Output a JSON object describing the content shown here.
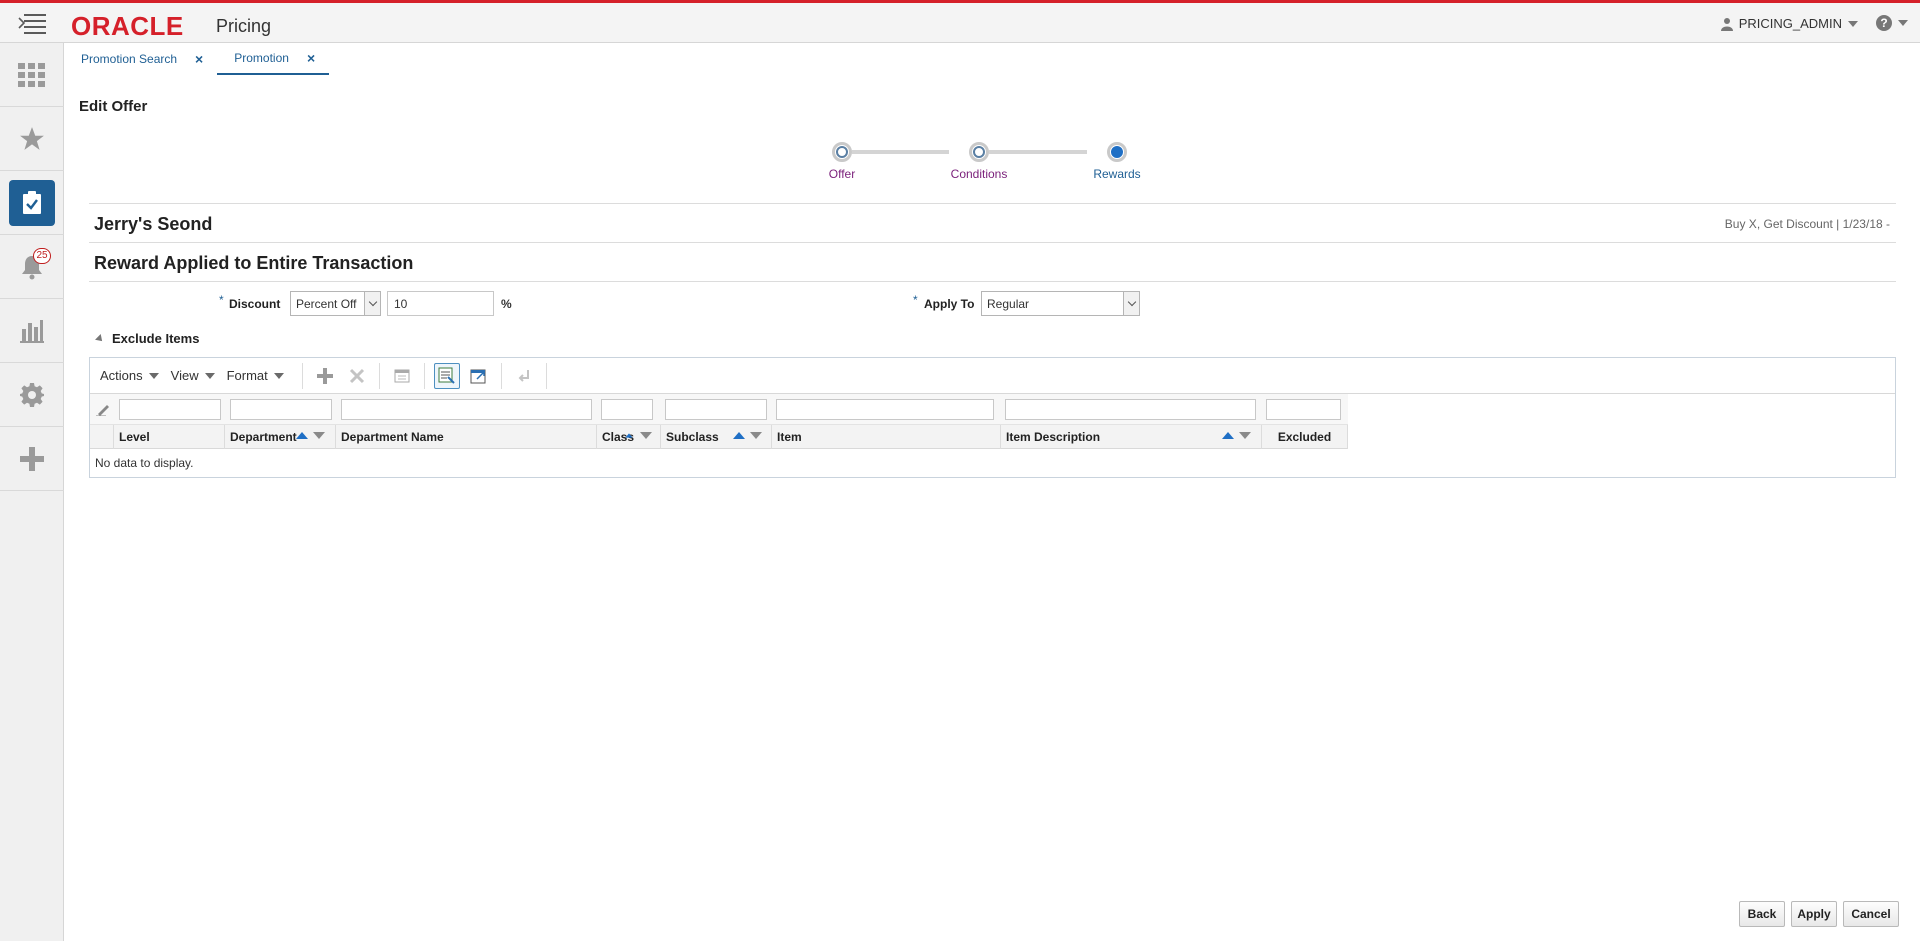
{
  "header": {
    "brand": "ORACLE",
    "app_name": "Pricing",
    "user": "PRICING_ADMIN",
    "brand_color": "#d5202a"
  },
  "rail": {
    "items": [
      {
        "icon": "apps-grid-icon"
      },
      {
        "icon": "star-icon"
      },
      {
        "icon": "clipboard-check-icon",
        "active": true
      },
      {
        "icon": "bell-icon",
        "badge": "25"
      },
      {
        "icon": "bar-chart-icon"
      },
      {
        "icon": "gear-icon"
      },
      {
        "icon": "add-plus-icon"
      }
    ]
  },
  "tabs": [
    {
      "label": "Promotion Search"
    },
    {
      "label": "Promotion",
      "active": true
    }
  ],
  "page": {
    "title": "Edit Offer"
  },
  "train": {
    "stops": [
      {
        "label": "Offer"
      },
      {
        "label": "Conditions"
      },
      {
        "label": "Rewards",
        "current": true
      }
    ]
  },
  "offer": {
    "name": "Jerry's Seond",
    "meta": "Buy X, Get Discount  |  1/23/18  -"
  },
  "reward": {
    "section_title": "Reward Applied to Entire Transaction",
    "required_mark": "*",
    "discount_label": "Discount",
    "discount_type": "Percent Off",
    "discount_value": "10",
    "discount_unit": "%",
    "apply_to_label": "Apply To",
    "apply_to_value": "Regular"
  },
  "exclude": {
    "title": "Exclude Items",
    "toolbar": {
      "actions": "Actions",
      "view": "View",
      "format": "Format"
    },
    "columns": [
      "Level",
      "Department",
      "Department Name",
      "Class",
      "Subclass",
      "Item",
      "Item Description",
      "Excluded"
    ],
    "empty_text": "No data to display."
  },
  "footer": {
    "back": "Back",
    "apply": "Apply",
    "cancel": "Cancel"
  }
}
